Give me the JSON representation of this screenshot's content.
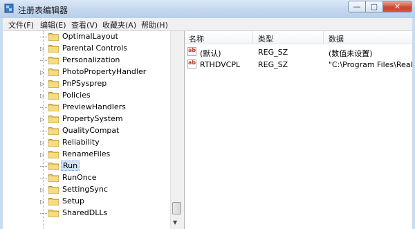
{
  "window": {
    "title": "注册表编辑器"
  },
  "window_buttons": {
    "minimize": "—",
    "maximize": "▢",
    "close": "✕"
  },
  "menu": [
    "文件(F)",
    "编辑(E)",
    "查看(V)",
    "收藏夹(A)",
    "帮助(H)"
  ],
  "tree": [
    {
      "label": "OptimalLayout",
      "expandable": false
    },
    {
      "label": "Parental Controls",
      "expandable": true
    },
    {
      "label": "Personalization",
      "expandable": false
    },
    {
      "label": "PhotoPropertyHandler",
      "expandable": true
    },
    {
      "label": "PnPSysprep",
      "expandable": true
    },
    {
      "label": "Policies",
      "expandable": true
    },
    {
      "label": "PreviewHandlers",
      "expandable": false
    },
    {
      "label": "PropertySystem",
      "expandable": true
    },
    {
      "label": "QualityCompat",
      "expandable": false
    },
    {
      "label": "Reliability",
      "expandable": true
    },
    {
      "label": "RenameFiles",
      "expandable": true
    },
    {
      "label": "Run",
      "expandable": false,
      "selected": true
    },
    {
      "label": "RunOnce",
      "expandable": false
    },
    {
      "label": "SettingSync",
      "expandable": true
    },
    {
      "label": "Setup",
      "expandable": true
    },
    {
      "label": "SharedDLLs",
      "expandable": false
    }
  ],
  "columns": {
    "name": "名称",
    "type": "类型",
    "data": "数据"
  },
  "values": [
    {
      "name": "(默认)",
      "type": "REG_SZ",
      "data": "(数值未设置)",
      "icon": "ab-string-icon"
    },
    {
      "name": "RTHDVCPL",
      "type": "REG_SZ",
      "data": "\"C:\\Program Files\\Realte",
      "icon": "ab-string-icon"
    }
  ],
  "colors": {
    "folder": "#e8c65a",
    "selection": "#cfe3f7",
    "frame": "#c9dcef"
  }
}
